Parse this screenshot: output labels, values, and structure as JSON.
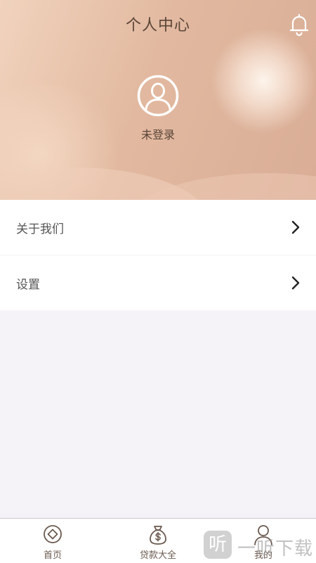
{
  "header": {
    "title": "个人中心",
    "bell_icon": "bell-icon",
    "avatar_icon": "user-avatar-icon",
    "login_status": "未登录"
  },
  "menu": {
    "items": [
      {
        "label": "关于我们",
        "icon": "chevron-right-icon"
      },
      {
        "label": "设置",
        "icon": "chevron-right-icon"
      }
    ]
  },
  "bottom_nav": {
    "items": [
      {
        "label": "首页",
        "icon": "home-diamond-icon",
        "active": false
      },
      {
        "label": "贷款大全",
        "icon": "money-bag-icon",
        "active": false
      },
      {
        "label": "我的",
        "icon": "user-icon",
        "active": true
      }
    ]
  },
  "watermark": {
    "badge": "听",
    "text": "一听下载"
  },
  "colors": {
    "header_gradient_start": "#f1d3bd",
    "header_gradient_end": "#d9ad96",
    "title_text": "#5a4538",
    "page_background": "#f5f3f8",
    "nav_text": "#6b5a50"
  }
}
